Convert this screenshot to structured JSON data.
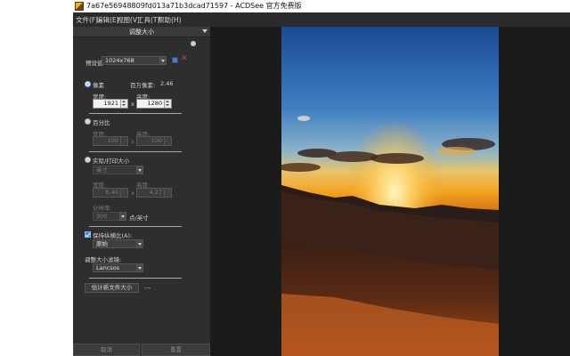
{
  "window": {
    "title": "7a67e56948809fd013a71b3dcad71597 - ACDSee 官方免费版"
  },
  "menu": [
    "文件(F)",
    "编辑(E)",
    "视图(V)",
    "工具(T)",
    "帮助(H)"
  ],
  "panel": {
    "title": "调整大小",
    "preset": {
      "label": "预设值",
      "value": "1024x768"
    },
    "pixels": {
      "label": "像素",
      "megapixels_label": "百万像素:",
      "megapixels_value": "2.46",
      "width_label": "宽度:",
      "height_label": "高度:",
      "width": "1921",
      "height": "1280",
      "times": "x"
    },
    "percent": {
      "label": "百分比",
      "width_label": "宽度:",
      "height_label": "高度:",
      "width": "100",
      "height": "100",
      "times": "x"
    },
    "print_size": {
      "label": "实际/打印大小",
      "unit": "英寸",
      "width_label": "宽度:",
      "height_label": "高度:",
      "width": "6.40",
      "height": "4.27",
      "times": "x",
      "resolution_label": "分辨率:",
      "resolution": "300",
      "resolution_unit": "点/英寸"
    },
    "keep_ratio": {
      "label": "保持纵横比(A):",
      "value": "原始"
    },
    "filter": {
      "label": "调整大小滤镜:",
      "value": "Lancsos"
    },
    "estimate": {
      "button": "估计新文件大小",
      "value": "---"
    },
    "footer": {
      "cancel": "取消",
      "reset": "重置"
    }
  },
  "colors": {
    "accent": "#2e86e8",
    "delete": "#e03a2e",
    "panel_bg": "#2e2e2e",
    "app_bg": "#1b1b1b"
  }
}
